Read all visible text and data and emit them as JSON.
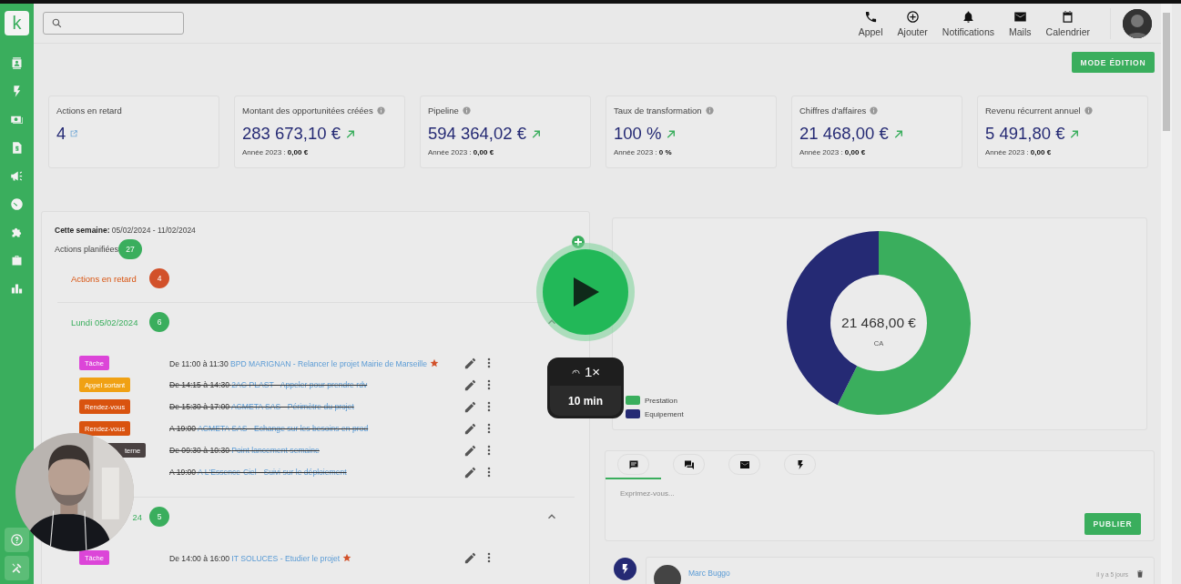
{
  "sidebar": {
    "logo": "k"
  },
  "top_nav": [
    {
      "label": "Appel"
    },
    {
      "label": "Ajouter"
    },
    {
      "label": "Notifications"
    },
    {
      "label": "Mails"
    },
    {
      "label": "Calendrier"
    }
  ],
  "edit_button": "MODE ÉDITION",
  "kpis": [
    {
      "kind": "count",
      "title": "Actions en retard",
      "value": "4"
    },
    {
      "kind": "amount",
      "title": "Montant des opportunitées créées",
      "value": "283 673,10 €",
      "sub_label": "Année 2023 :",
      "sub_value": "0,00 €"
    },
    {
      "kind": "amount",
      "title": "Pipeline",
      "value": "594 364,02 €",
      "sub_label": "Année 2023 :",
      "sub_value": "0,00 €"
    },
    {
      "kind": "amount",
      "title": "Taux de transformation",
      "value": "100 %",
      "sub_label": "Année 2023 :",
      "sub_value": "0 %"
    },
    {
      "kind": "amount",
      "title": "Chiffres d'affaires",
      "value": "21 468,00 €",
      "sub_label": "Année 2023 :",
      "sub_value": "0,00 €"
    },
    {
      "kind": "amount",
      "title": "Revenu récurrent annuel",
      "value": "5 491,80 €",
      "sub_label": "Année 2023 :",
      "sub_value": "0,00 €"
    }
  ],
  "week": {
    "label": "Cette semaine:",
    "dates": "05/02/2024 - 11/02/2024",
    "planned_label": "Actions planifiées",
    "planned_count": "27",
    "late_label": "Actions en retard",
    "late_count": "4",
    "days": [
      {
        "label": "Lundi 05/02/2024",
        "count": "6",
        "clipped": false,
        "tasks": [
          {
            "tag": "Tâche",
            "color": "#dc45d8",
            "time": "De 11:00 à 11:30",
            "title": "BPD MARIGNAN - Relancer le projet Mairie de Marseille",
            "done": false,
            "starred": true,
            "clipped": false
          },
          {
            "tag": "Appel sortant",
            "color": "#f0a114",
            "time": "De 14:15 à 14:30",
            "title": "2AC PLAST - Appeler pour prendre rdv",
            "done": true,
            "starred": false,
            "clipped": false
          },
          {
            "tag": "Rendez-vous",
            "color": "#d9530f",
            "time": "De 15:30 à 17:00",
            "title": "ACMETA SAS - Périmètre du projet",
            "done": true,
            "starred": false,
            "clipped": false
          },
          {
            "tag": "Rendez-vous",
            "color": "#d9530f",
            "time": "A 19:00",
            "title": "ACMETA SAS - Echange sur les besoins en prod",
            "done": true,
            "starred": false,
            "clipped": false
          },
          {
            "tag": "terne",
            "color": "#4a4242",
            "time": "De 09:30 à 10:30",
            "title": "Point lancement semaine",
            "done": true,
            "starred": false,
            "clipped": true
          },
          {
            "time": "A 19:00",
            "title": "A L'Essence-Ciel - Suivi sur le déploiement",
            "done": true,
            "starred": false
          }
        ]
      },
      {
        "label": "24",
        "count": "5",
        "clipped": true,
        "tasks": [
          {
            "tag": "Tâche",
            "color": "#dc45d8",
            "time": "De 14:00 à 16:00",
            "title": "IT SOLUCES - Etudier le projet",
            "done": false,
            "starred": true,
            "clipped": false
          }
        ]
      }
    ]
  },
  "chart": {
    "total": "21 468,00 €",
    "label": "CA",
    "legend": [
      {
        "label": "Prestation",
        "color": "#3aae5d"
      },
      {
        "label": "Equipement",
        "color": "#252a74"
      }
    ]
  },
  "composer": {
    "tabs": [
      {
        "selected": true
      },
      {
        "selected": false
      },
      {
        "selected": false
      },
      {
        "selected": false
      }
    ],
    "placeholder": "Exprimez-vous...",
    "button": "PUBLIER"
  },
  "feed": [
    {
      "author": "Marc Buggo",
      "time": "il y a 5 jours"
    }
  ],
  "player": {
    "speed": "1×",
    "duration": "10 min"
  }
}
